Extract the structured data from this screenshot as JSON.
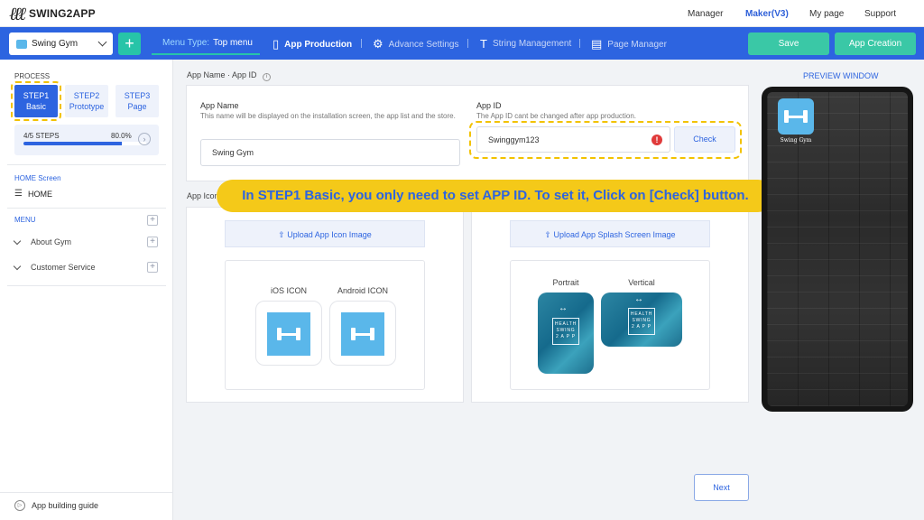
{
  "brand": {
    "name": "SWING2APP",
    "mark": "ℓℓℓ"
  },
  "top_nav": {
    "manager": "Manager",
    "maker": "Maker(V3)",
    "my_page": "My page",
    "support": "Support"
  },
  "toolbar": {
    "app_select": "Swing Gym",
    "add": "+",
    "menu_type_label": "Menu Type:",
    "menu_type_value": "Top menu",
    "app_production": "App Production",
    "advance_settings": "Advance Settings",
    "string_management": "String Management",
    "page_manager": "Page Manager",
    "save": "Save",
    "app_creation": "App Creation"
  },
  "sidebar": {
    "process_label": "PROCESS",
    "steps": [
      {
        "line1": "STEP1",
        "line2": "Basic"
      },
      {
        "line1": "STEP2",
        "line2": "Prototype"
      },
      {
        "line1": "STEP3",
        "line2": "Page"
      }
    ],
    "progress": {
      "steps_text": "4/5 STEPS",
      "percent_text": "80.0%",
      "fraction": 0.8
    },
    "home_screen_label": "HOME Screen",
    "home_item": "HOME",
    "menu_label": "MENU",
    "menu_items": [
      "About Gym",
      "Customer Service"
    ],
    "guide": "App building guide"
  },
  "main": {
    "section1_title": "App Name · App ID",
    "info_icon": "i",
    "app_name": {
      "title": "App Name",
      "desc": "This name will be displayed on the installation screen, the app list and the store.",
      "value": "Swing Gym"
    },
    "app_id": {
      "title": "App ID",
      "desc": "The App ID cant be changed after app production.",
      "value": "Swinggym123",
      "error": "!",
      "check": "Check"
    },
    "section2_title": "App Icon",
    "upload_icon": "Upload App Icon Image",
    "upload_splash": "Upload App Splash Screen Image",
    "ios_icon": "iOS ICON",
    "android_icon": "Android ICON",
    "portrait": "Portrait",
    "vertical": "Vertical",
    "splash_logo": [
      "HEALTH",
      "SWING",
      "2 A P P"
    ],
    "next": "Next"
  },
  "preview": {
    "label": "PREVIEW WINDOW",
    "app_name": "Swing Gym"
  },
  "callout": "In STEP1 Basic, you only need to set APP ID. To set it, Click on [Check] button.",
  "colors": {
    "primary": "#2d64e0",
    "accent": "#3ac8a6",
    "highlight": "#f4c919",
    "icon_bg": "#5ab7ea",
    "error": "#e03b3b"
  }
}
